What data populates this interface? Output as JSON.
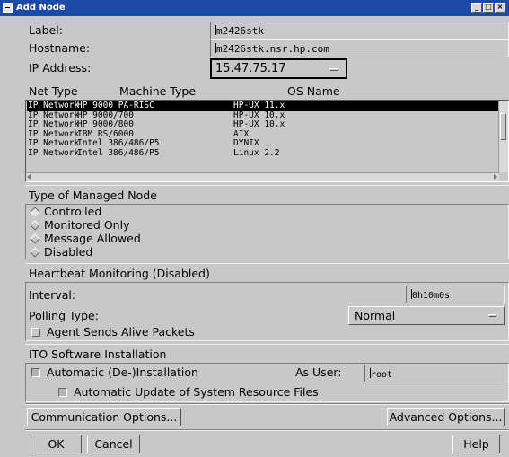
{
  "window": {
    "title": "Add Node",
    "minimize_glyph": "_",
    "maximize_glyph": "□",
    "close_glyph": "×"
  },
  "form": {
    "label_caption": "Label:",
    "label_value": "m2426stk",
    "hostname_caption": "Hostname:",
    "hostname_value": "m2426stk.nsr.hp.com",
    "ip_caption": "IP Address:",
    "ip_value": "15.47.75.17"
  },
  "node_list": {
    "columns": [
      "Net Type",
      "Machine Type",
      "OS Name"
    ],
    "rows": [
      [
        "IP Network",
        "HP 9000 PA-RISC",
        "HP-UX 11.x"
      ],
      [
        "IP Network",
        "HP 9000/700",
        "HP-UX 10.x"
      ],
      [
        "IP Network",
        "HP 9000/800",
        "HP-UX 10.x"
      ],
      [
        "IP Network",
        "IBM RS/6000",
        "AIX"
      ],
      [
        "IP Network",
        "Intel 386/486/P5",
        "DYNIX"
      ],
      [
        "IP Network",
        "Intel 386/486/P5",
        "Linux 2.2"
      ]
    ],
    "selected_row": 0
  },
  "managed_node": {
    "heading": "Type of Managed Node",
    "options": [
      "Controlled",
      "Monitored Only",
      "Message Allowed",
      "Disabled"
    ],
    "selected": "Controlled"
  },
  "heartbeat": {
    "heading": "Heartbeat Monitoring (Disabled)",
    "interval_caption": "Interval:",
    "interval_value": "0h10m0s",
    "polling_caption": "Polling Type:",
    "polling_value": "Normal",
    "agent_packets_label": "Agent Sends Alive Packets",
    "agent_packets_checked": false
  },
  "ito": {
    "heading": "ITO Software Installation",
    "auto_install_label": "Automatic (De-)Installation",
    "auto_install_checked": false,
    "as_user_caption": "As User:",
    "as_user_value": "root",
    "auto_update_label": "Automatic Update of System Resource Files",
    "auto_update_checked": false
  },
  "buttons": {
    "comm_options": "Communication Options...",
    "adv_options": "Advanced Options...",
    "ok": "OK",
    "cancel": "Cancel",
    "help": "Help"
  }
}
